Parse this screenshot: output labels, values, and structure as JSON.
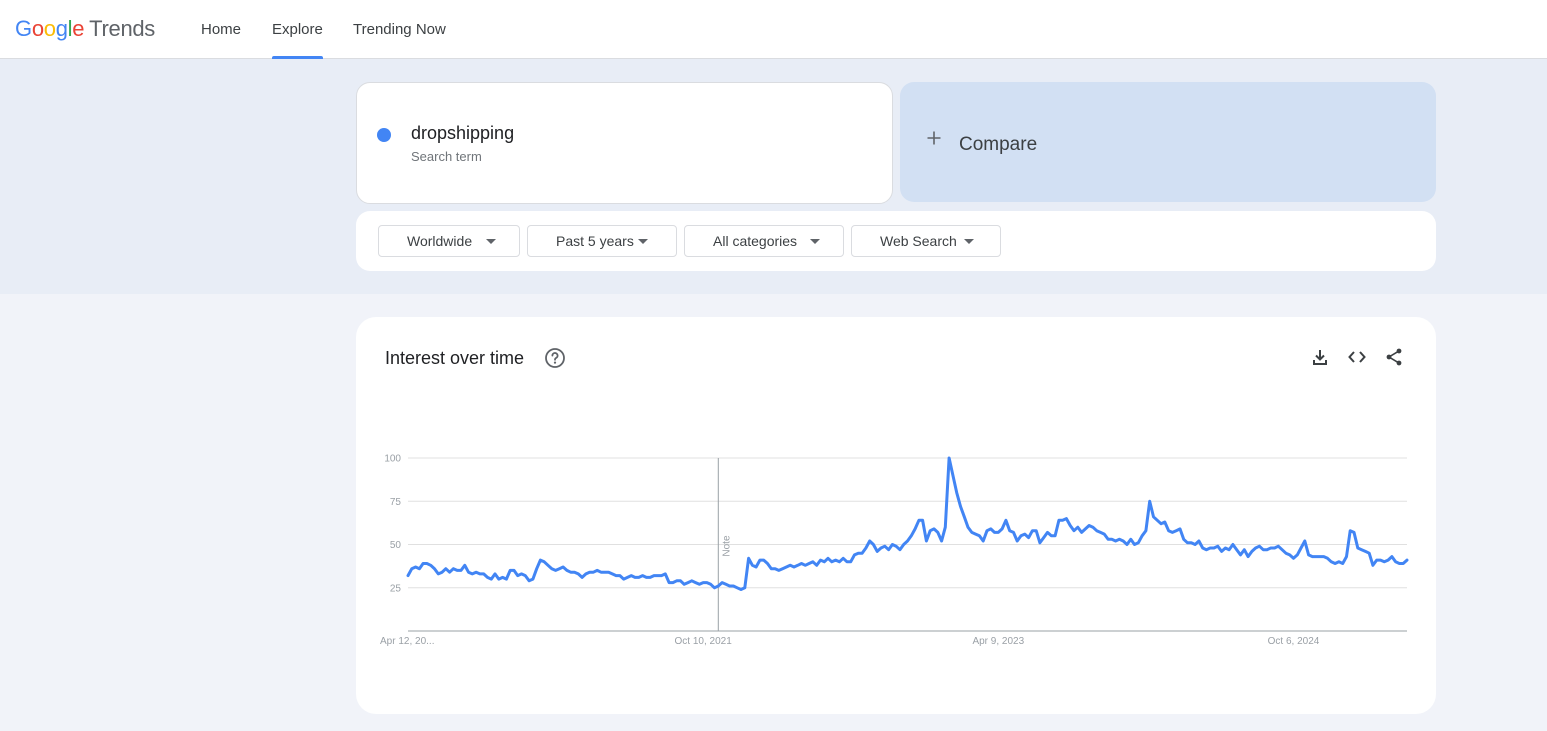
{
  "header": {
    "logo": {
      "google": [
        "G",
        "o",
        "o",
        "g",
        "l",
        "e"
      ],
      "product": "Trends"
    },
    "nav": [
      {
        "label": "Home",
        "active": false
      },
      {
        "label": "Explore",
        "active": true
      },
      {
        "label": "Trending Now",
        "active": false
      }
    ]
  },
  "search": {
    "term": "dropshipping",
    "term_type": "Search term",
    "term_color": "#4285f4",
    "compare_label": "Compare"
  },
  "filters": {
    "region": "Worldwide",
    "time_range": "Past 5 years",
    "category": "All categories",
    "property": "Web Search"
  },
  "card": {
    "title": "Interest over time",
    "icons": [
      "help-icon",
      "download-icon",
      "embed-icon",
      "share-icon"
    ]
  },
  "chart_data": {
    "type": "line",
    "title": "",
    "xlabel": "",
    "ylabel": "",
    "ylim": [
      0,
      100
    ],
    "y_ticks": [
      25,
      50,
      75,
      100
    ],
    "x_tick_labels": [
      "Apr 12, 20...",
      "Oct 10, 2021",
      "Apr 9, 2023",
      "Oct 6, 2024"
    ],
    "x_tick_index": [
      0,
      78,
      156,
      234
    ],
    "note": {
      "label": "Note",
      "index": 82
    },
    "grid": true,
    "legend": "none",
    "series": [
      {
        "color": "#4285f4",
        "values": [
          32,
          36,
          37,
          36,
          39,
          39,
          38,
          36,
          33,
          34,
          36,
          34,
          36,
          35,
          35,
          38,
          34,
          33,
          34,
          33,
          33,
          31,
          30,
          33,
          30,
          31,
          30,
          35,
          35,
          32,
          33,
          32,
          29,
          30,
          36,
          41,
          40,
          38,
          36,
          35,
          36,
          37,
          35,
          34,
          34,
          33,
          31,
          33,
          34,
          34,
          35,
          34,
          34,
          34,
          33,
          32,
          32,
          30,
          31,
          32,
          31,
          31,
          32,
          31,
          31,
          32,
          32,
          32,
          33,
          28,
          28,
          29,
          29,
          27,
          28,
          29,
          28,
          27,
          28,
          28,
          27,
          25,
          26,
          28,
          27,
          26,
          26,
          25,
          24,
          25,
          42,
          38,
          37,
          41,
          41,
          39,
          36,
          36,
          35,
          36,
          37,
          38,
          37,
          38,
          39,
          38,
          39,
          40,
          38,
          41,
          40,
          42,
          40,
          41,
          40,
          42,
          40,
          40,
          44,
          45,
          45,
          48,
          52,
          50,
          46,
          48,
          49,
          47,
          50,
          49,
          47,
          50,
          52,
          55,
          59,
          64,
          64,
          52,
          58,
          59,
          57,
          52,
          60,
          100,
          90,
          80,
          72,
          66,
          60,
          57,
          56,
          55,
          52,
          58,
          59,
          57,
          57,
          59,
          64,
          58,
          57,
          52,
          55,
          56,
          54,
          58,
          58,
          51,
          54,
          57,
          55,
          55,
          64,
          64,
          65,
          61,
          58,
          60,
          57,
          59,
          61,
          60,
          58,
          57,
          56,
          53,
          53,
          52,
          53,
          52,
          50,
          53,
          50,
          51,
          55,
          58,
          75,
          66,
          64,
          62,
          63,
          58,
          57,
          58,
          59,
          53,
          51,
          51,
          50,
          52,
          48,
          47,
          48,
          48,
          49,
          46,
          48,
          47,
          50,
          47,
          44,
          47,
          43,
          46,
          48,
          49,
          47,
          47,
          48,
          48,
          49,
          47,
          45,
          44,
          42,
          44,
          48,
          52,
          44,
          43,
          43,
          43,
          43,
          42,
          40,
          39,
          40,
          39,
          43,
          58,
          57,
          48,
          47,
          46,
          45,
          38,
          41,
          41,
          40,
          41,
          43,
          40,
          39,
          39,
          41
        ]
      }
    ]
  }
}
